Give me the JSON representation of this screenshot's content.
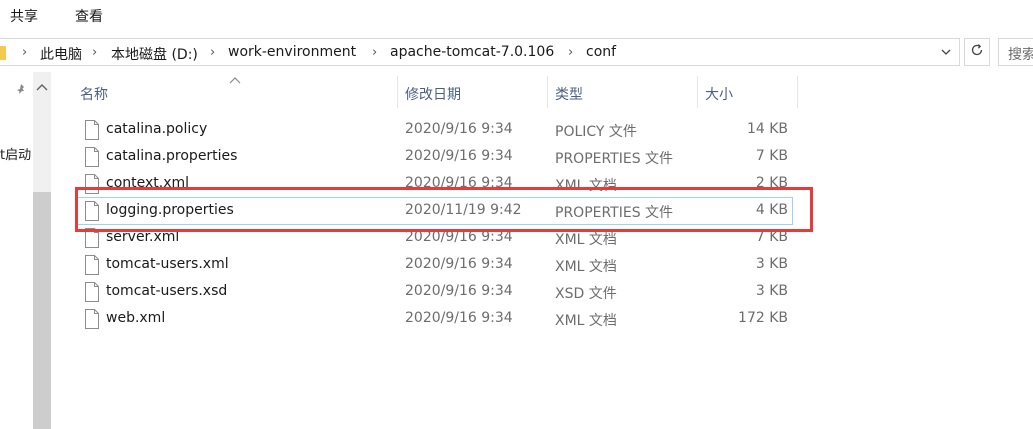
{
  "ribbon": {
    "tabs": [
      "共享",
      "查看"
    ]
  },
  "address": {
    "crumbs": [
      "此电脑",
      "本地磁盘 (D:)",
      "work-environment",
      "apache-tomcat-7.0.106",
      "conf"
    ]
  },
  "search": {
    "placeholder": "搜索"
  },
  "nav": {
    "partial_item": "t启动"
  },
  "columns": {
    "name": "名称",
    "modified": "修改日期",
    "type": "类型",
    "size": "大小"
  },
  "files": [
    {
      "name": "catalina.policy",
      "modified": "2020/9/16 9:34",
      "type": "POLICY 文件",
      "size": "14 KB"
    },
    {
      "name": "catalina.properties",
      "modified": "2020/9/16 9:34",
      "type": "PROPERTIES 文件",
      "size": "7 KB"
    },
    {
      "name": "context.xml",
      "modified": "2020/9/16 9:34",
      "type": "XML 文档",
      "size": "2 KB"
    },
    {
      "name": "logging.properties",
      "modified": "2020/11/19 9:42",
      "type": "PROPERTIES 文件",
      "size": "4 KB"
    },
    {
      "name": "server.xml",
      "modified": "2020/9/16 9:34",
      "type": "XML 文档",
      "size": "7 KB"
    },
    {
      "name": "tomcat-users.xml",
      "modified": "2020/9/16 9:34",
      "type": "XML 文档",
      "size": "3 KB"
    },
    {
      "name": "tomcat-users.xsd",
      "modified": "2020/9/16 9:34",
      "type": "XSD 文件",
      "size": "3 KB"
    },
    {
      "name": "web.xml",
      "modified": "2020/9/16 9:34",
      "type": "XML 文档",
      "size": "172 KB"
    }
  ],
  "colors": {
    "highlight": "#e53b3b",
    "header_text": "#4d6082",
    "selection_border": "#99d1ff"
  }
}
